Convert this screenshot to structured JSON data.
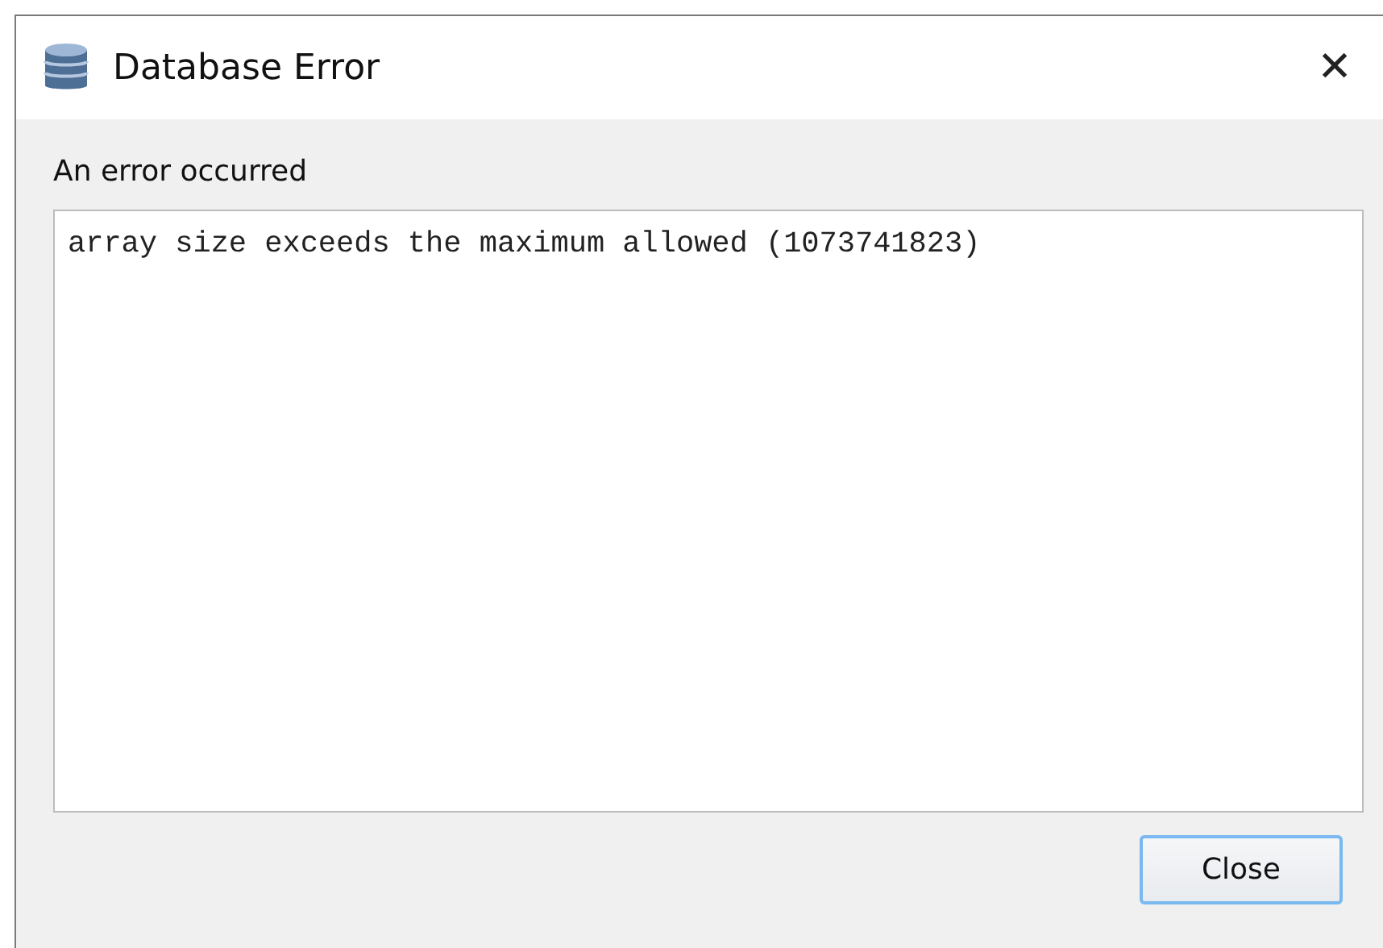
{
  "window": {
    "title": "Database Error",
    "close_glyph": "✕"
  },
  "message_label": "An error occurred",
  "message_text": "array size exceeds the maximum allowed (1073741823)",
  "buttons": [
    {
      "label": "Close",
      "selected": true
    }
  ]
}
